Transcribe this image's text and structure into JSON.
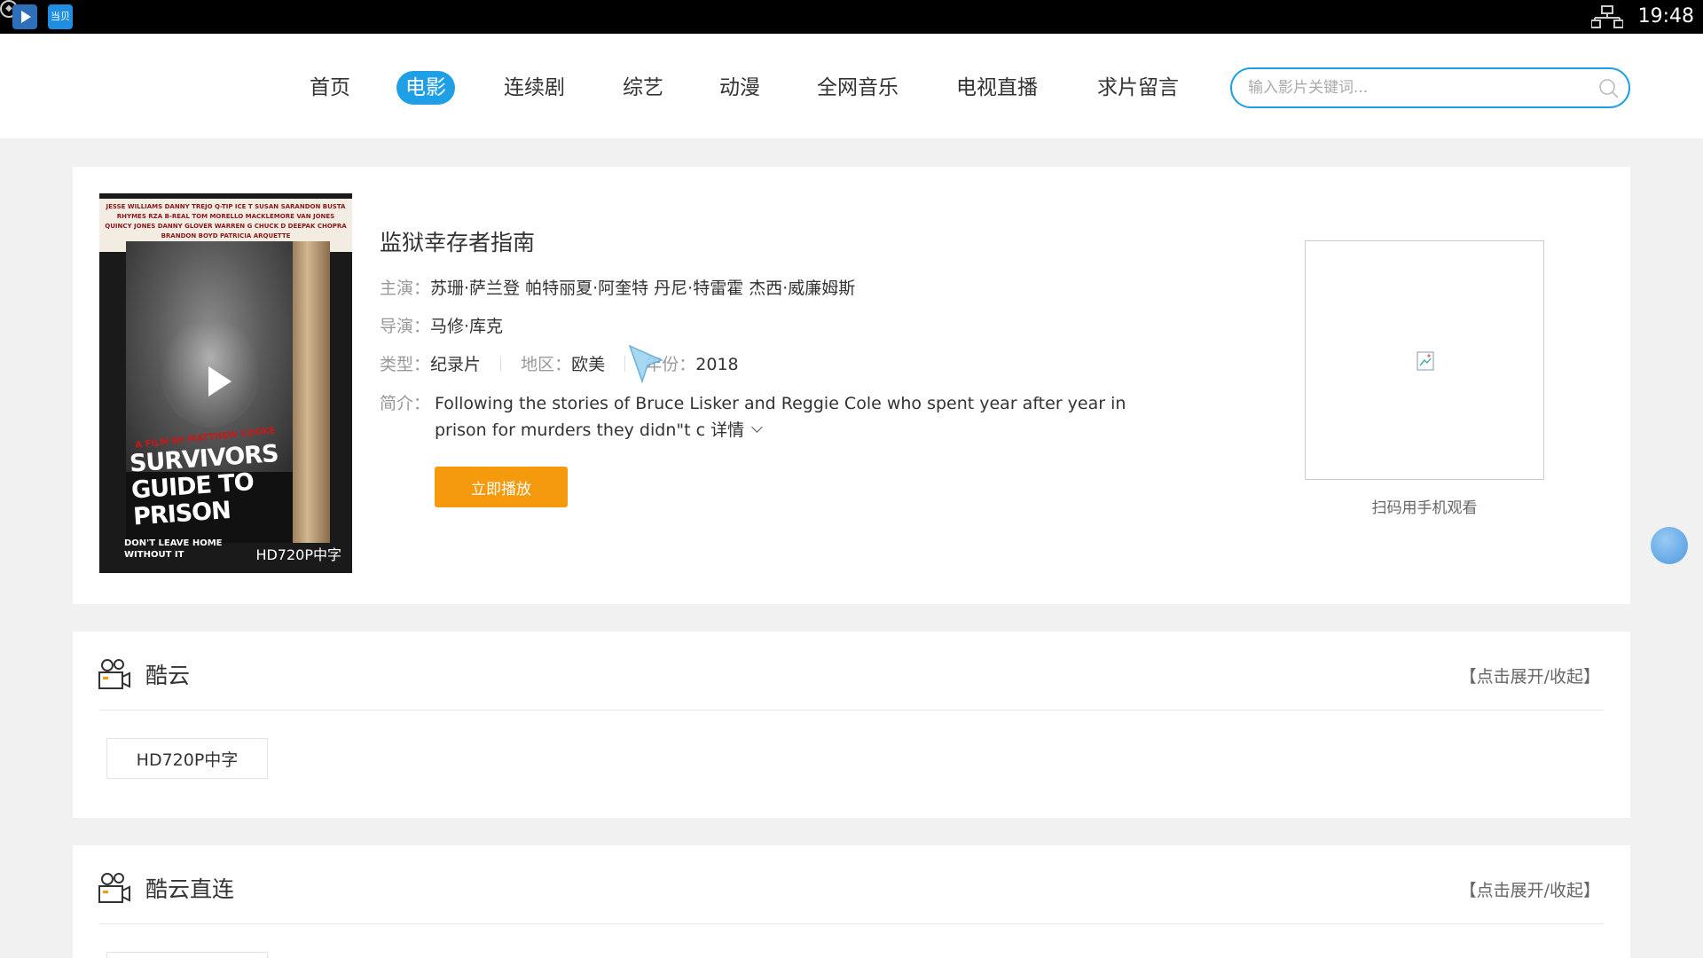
{
  "status_bar": {
    "app2_label": "当贝",
    "time": "19:48"
  },
  "nav": {
    "items": [
      {
        "label": "首页",
        "active": false
      },
      {
        "label": "电影",
        "active": true
      },
      {
        "label": "连续剧",
        "active": false
      },
      {
        "label": "综艺",
        "active": false
      },
      {
        "label": "动漫",
        "active": false
      },
      {
        "label": "全网音乐",
        "active": false
      },
      {
        "label": "电视直播",
        "active": false
      },
      {
        "label": "求片留言",
        "active": false
      }
    ],
    "search_placeholder": "输入影片关键词..."
  },
  "movie": {
    "title": "监狱幸存者指南",
    "cast_label": "主演：",
    "cast": "苏珊·萨兰登 帕特丽夏·阿奎特 丹尼·特雷霍 杰西·威廉姆斯",
    "director_label": "导演：",
    "director": "马修·库克",
    "genre_label": "类型：",
    "genre": "纪录片",
    "region_label": "地区：",
    "region": "欧美",
    "year_label": "年份：",
    "year": "2018",
    "intro_label": "简介：",
    "intro": "Following the stories of Bruce Lisker and Reggie Cole who spent year after year in prison for murders they didn\"t c",
    "more_label": "详情",
    "play_button": "立即播放",
    "qr_caption": "扫码用手机观看",
    "poster": {
      "credits": "JESSE WILLIAMS  DANNY TREJO  Q-TIP  ICE T  SUSAN SARANDON  BUSTA RHYMES  RZA  B-REAL  TOM MORELLO  MACKLEMORE  VAN JONES  QUINCY JONES  DANNY GLOVER  WARREN G  CHUCK D  DEEPAK CHOPRA  BRANDON BOYD  PATRICIA ARQUETTE",
      "byline": "A FILM BY MATTHEW COOKE",
      "title": "SURVIVORS GUIDE TO PRISON",
      "tagline": "DON'T LEAVE HOME WITHOUT IT",
      "quality": "HD720P中字"
    }
  },
  "sources": [
    {
      "name": "酷云",
      "toggle": "【点击展开/收起】",
      "episodes": [
        "HD720P中字"
      ]
    },
    {
      "name": "酷云直连",
      "toggle": "【点击展开/收起】",
      "episodes": [
        ""
      ]
    }
  ]
}
